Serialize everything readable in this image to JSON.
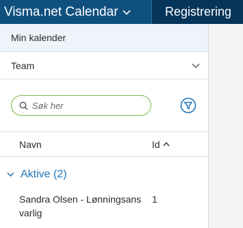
{
  "topbar": {
    "app_title": "Visma.net Calendar",
    "tab_label": "Registrering"
  },
  "sidebar": {
    "my_calendar": "Min kalender",
    "team_label": "Team",
    "search_placeholder": "Søk her",
    "columns": {
      "name": "Navn",
      "id": "Id"
    },
    "group": {
      "label": "Aktive (2)"
    },
    "rows": [
      {
        "name": "Sandra Olsen - Lønningsansvarlig",
        "id": "1"
      }
    ]
  },
  "colors": {
    "topbar_bg": "#0d4a7a",
    "accent_blue": "#1f73b7",
    "search_border": "#7ab648"
  }
}
